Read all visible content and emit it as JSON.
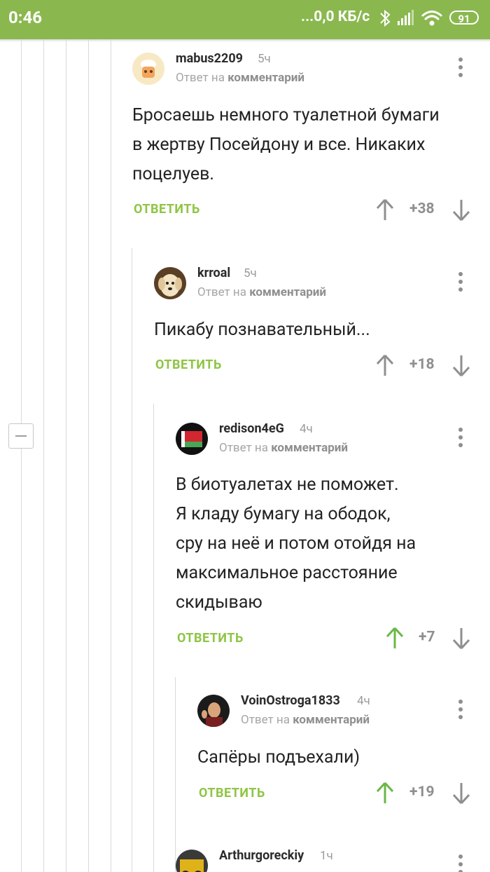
{
  "status_bar": {
    "time": "0:46",
    "network_speed": "...0,0 КБ/с",
    "battery": "91"
  },
  "colors": {
    "accent": "#8ab84f",
    "answer": "#8ec544",
    "upvoted": "#6ab845",
    "neutral": "#8f8f8f"
  },
  "comments": [
    {
      "username": "mabus2209",
      "time": "5ч",
      "reply_prefix": "Ответ на",
      "reply_link": "комментарий",
      "lines": [
        "Бросаешь немного туалетной бумаги",
        "в жертву Посейдону и все. Никаких",
        "поцелуев."
      ],
      "answer_label": "ОТВЕТИТЬ",
      "score": "+38",
      "upvoted": false
    },
    {
      "username": "krroal",
      "time": "5ч",
      "reply_prefix": "Ответ на",
      "reply_link": "комментарий",
      "lines": [
        "Пикабу познавательный..."
      ],
      "answer_label": "ОТВЕТИТЬ",
      "score": "+18",
      "upvoted": false
    },
    {
      "username": "redison4eG",
      "time": "4ч",
      "reply_prefix": "Ответ на",
      "reply_link": "комментарий",
      "lines": [
        "В биотуалетах не поможет.",
        "Я кладу бумагу на ободок,",
        "сру на неё и потом отойдя на",
        "максимальное расстояние",
        "скидываю"
      ],
      "answer_label": "ОТВЕТИТЬ",
      "score": "+7",
      "upvoted": true
    },
    {
      "username": "VoinOstroga1833",
      "time": "4ч",
      "reply_prefix": "Ответ на",
      "reply_link": "комментарий",
      "lines": [
        "Сапёры подъехали)"
      ],
      "answer_label": "ОТВЕТИТЬ",
      "score": "+19",
      "upvoted": true
    },
    {
      "username": "Arthurgoreckiy",
      "time": "1ч"
    }
  ]
}
